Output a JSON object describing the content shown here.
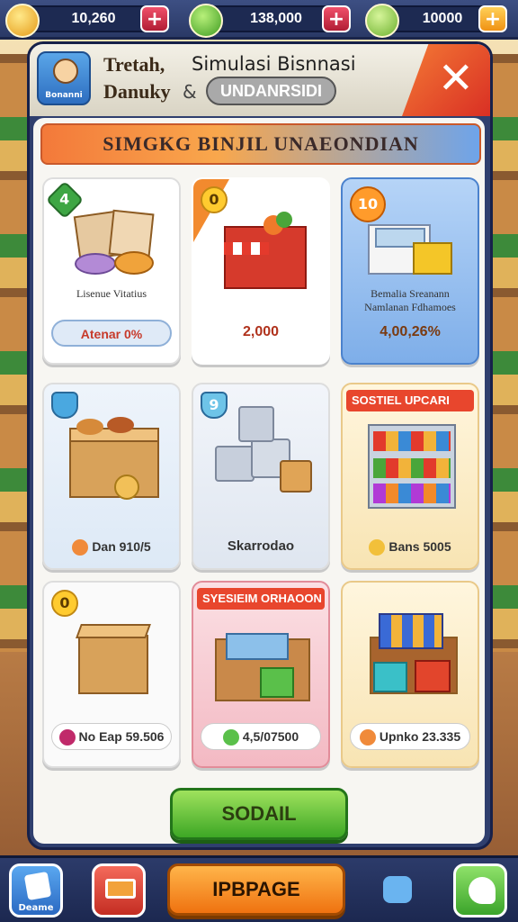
{
  "resources": {
    "coins": "10,260",
    "cash": "138,000",
    "gems": "10000"
  },
  "header": {
    "player_line1": "Tretah,",
    "player_line2": "Danuky",
    "badge_label": "Bonanni",
    "title": "Simulasi Bisnnasi",
    "amp": "&",
    "subtitle": "UNDANRSIDI"
  },
  "banner": "SIMGKG BINJIL UNAEONDIAN",
  "cards": [
    {
      "badge": "4",
      "label": "Lisenue Vitatius",
      "price": "Atenar 0%"
    },
    {
      "badge": "0",
      "label": "",
      "price": "2,000"
    },
    {
      "badge": "10",
      "label": "Bemalia Sreanann Namlanan Fdhamoes",
      "price": "4,00,26%"
    },
    {
      "badge": "",
      "label": "",
      "price": "Dan 910/5"
    },
    {
      "badge": "9",
      "label": "",
      "price": "Skarrodao"
    },
    {
      "ribbon": "SOSTIEL UPCARI",
      "label": "",
      "price": "Bans 5005"
    },
    {
      "badge": "0",
      "label": "",
      "price": "No Eap 59.506"
    },
    {
      "ribbon": "SYESIEIM ORHAOON",
      "label": "",
      "price": "4,5/07500"
    },
    {
      "badge": "",
      "label": "",
      "price": "Upnko 23.335"
    }
  ],
  "sold_button": "SODAIL",
  "bottom_nav": {
    "home_label": "Deame",
    "upgrade_label": "IPBPAGE"
  },
  "colors": {
    "accent_orange": "#ef7210",
    "accent_green": "#3da725",
    "panel_navy": "#2f3f6e"
  }
}
